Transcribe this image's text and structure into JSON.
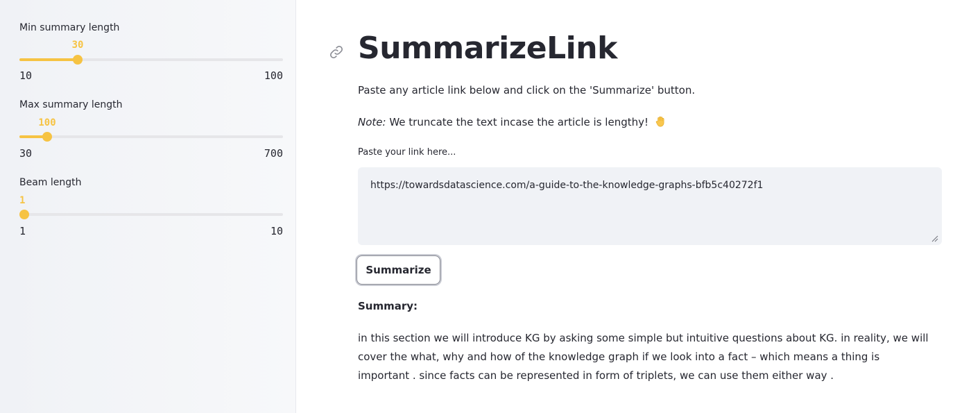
{
  "sidebar": {
    "sliders": [
      {
        "label": "Min summary length",
        "min": "10",
        "max": "100",
        "value": "30",
        "fraction": 0.2222
      },
      {
        "label": "Max summary length",
        "min": "30",
        "max": "700",
        "value": "100",
        "fraction": 0.1045
      },
      {
        "label": "Beam length",
        "min": "1",
        "max": "10",
        "value": "1",
        "fraction": 0.0
      }
    ]
  },
  "main": {
    "title": "SummarizeLink",
    "intro": "Paste any article link below and click on the 'Summarize' button.",
    "note_label": "Note:",
    "note_text": " We truncate the text incase the article is lengthy!",
    "note_icon": "raised-hand-icon",
    "input_label": "Paste your link here...",
    "input_value": "https://towardsdatascience.com/a-guide-to-the-knowledge-graphs-bfb5c40272f1",
    "button_label": "Summarize",
    "summary_heading": "Summary:",
    "summary_text": "in this section we will introduce KG by asking some simple but intuitive questions about KG. in reality, we will cover the what, why and how of the knowledge graph if we look into a fact – which means a thing is important . since facts can be represented in form of triplets, we can use them either way ."
  },
  "colors": {
    "accent": "#f6c343",
    "sidebar_bg": "#f0f2f6",
    "text": "#262730"
  }
}
